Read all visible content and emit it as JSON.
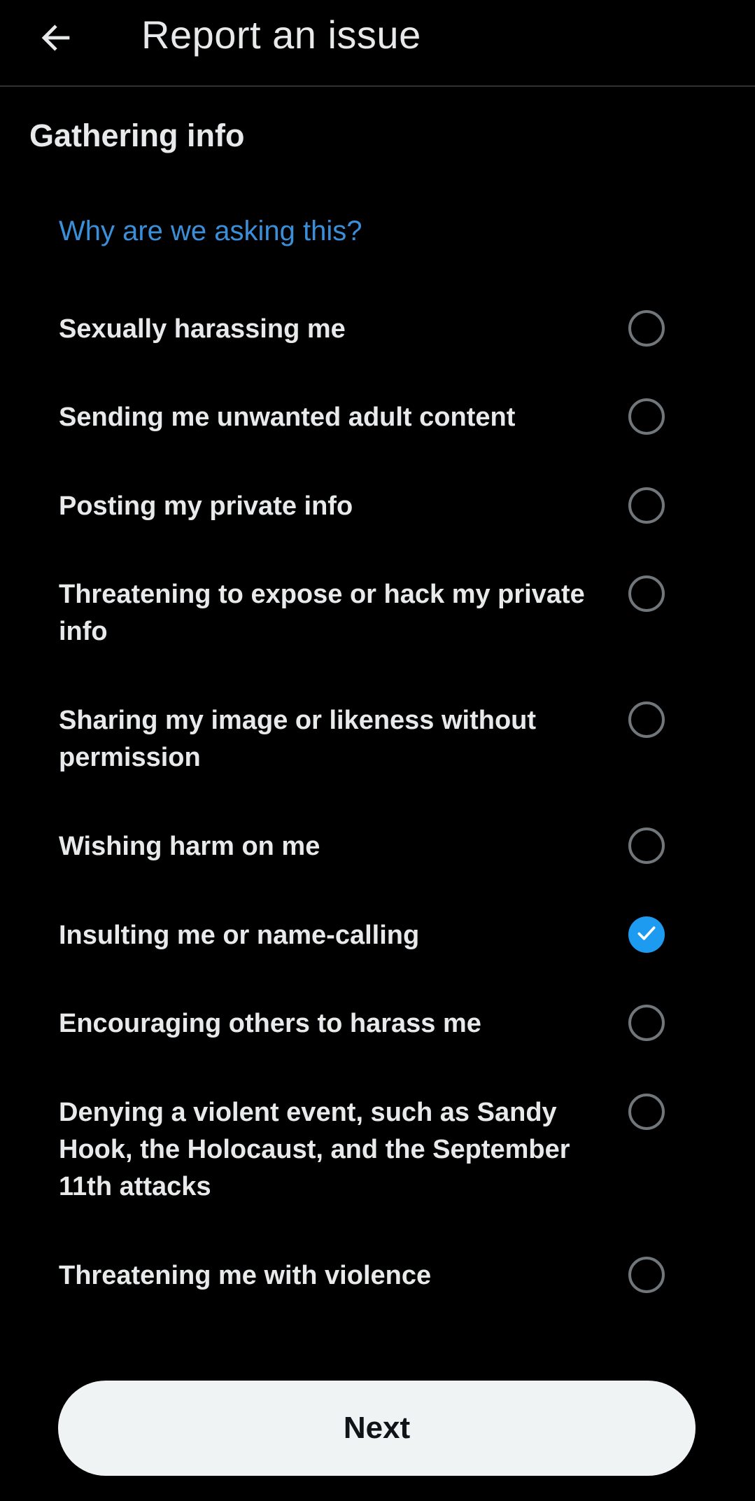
{
  "header": {
    "title": "Report an issue",
    "back_icon": "arrow-left-icon"
  },
  "section": {
    "title": "Gathering info",
    "why_link": "Why are we asking this?"
  },
  "options": [
    {
      "label": "Sexually harassing me",
      "checked": false
    },
    {
      "label": "Sending me unwanted adult content",
      "checked": false
    },
    {
      "label": "Posting my private info",
      "checked": false
    },
    {
      "label": "Threatening to expose or hack my private info",
      "checked": false
    },
    {
      "label": "Sharing my image or likeness without permission",
      "checked": false
    },
    {
      "label": "Wishing harm on me",
      "checked": false
    },
    {
      "label": "Insulting me or name-calling",
      "checked": true
    },
    {
      "label": "Encouraging others to harass me",
      "checked": false
    },
    {
      "label": "Denying a violent event, such as Sandy Hook, the Holocaust, and the September 11th attacks",
      "checked": false
    },
    {
      "label": "Threatening me with violence",
      "checked": false
    }
  ],
  "footer": {
    "next_label": "Next"
  },
  "colors": {
    "accent": "#1d9bf0",
    "link": "#3b8fd9",
    "background": "#000000",
    "button_bg": "#eff3f4"
  }
}
